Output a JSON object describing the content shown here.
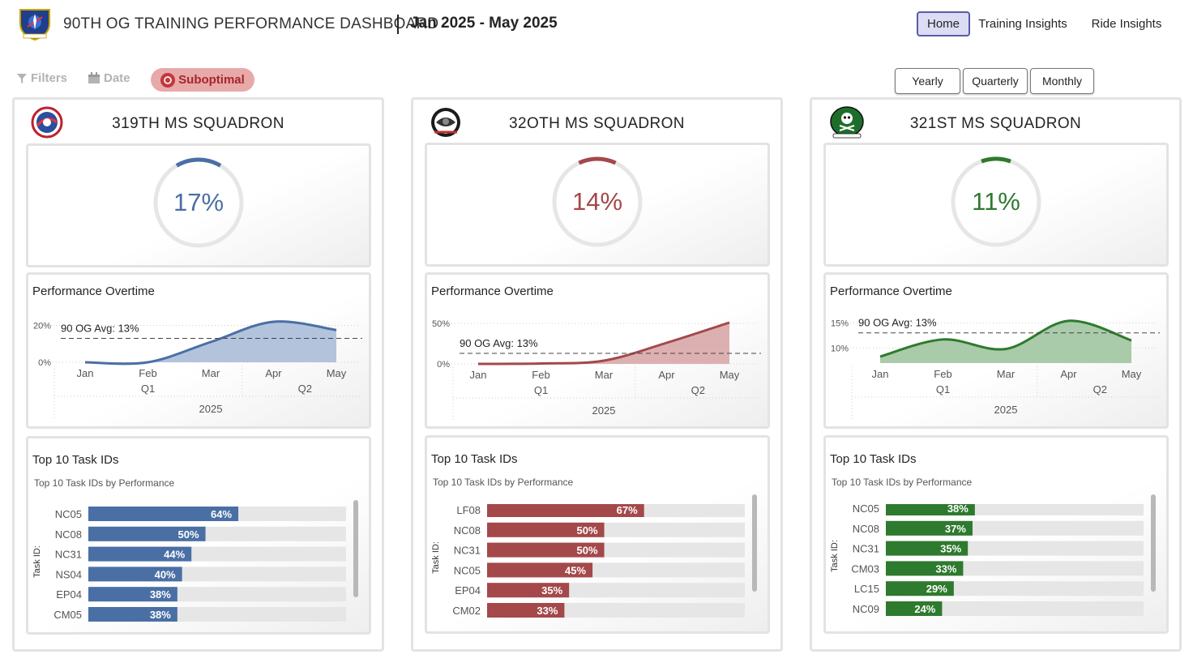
{
  "header": {
    "title": "90TH OG TRAINING PERFORMANCE DASHBOARD",
    "date_range": "Jan 2025 - May 2025",
    "logo_icon": "90th-og-wing-emblem-icon",
    "nav": [
      "Home",
      "Training Insights",
      "Ride Insights"
    ],
    "active_nav": "Home"
  },
  "toolbar": {
    "filters_label": "Filters",
    "date_label": "Date",
    "suboptimal_label": "Suboptimal"
  },
  "period_buttons": [
    "Yearly",
    "Quarterly",
    "Monthly"
  ],
  "squadrons": [
    {
      "name": "319TH MS SQUADRON",
      "logo_icon": "319th-squadron-patch-icon",
      "color": "#4a6fa5",
      "fill": "#b3c3dc",
      "kpi": "17%",
      "kpi_value": 0.17,
      "perf_title": "Performance Overtime",
      "chart_data": {
        "type": "area",
        "x": [
          "Jan",
          "Feb",
          "Mar",
          "Apr",
          "May"
        ],
        "quarters": [
          "Q1",
          "Q2"
        ],
        "year": "2025",
        "values": [
          0,
          0,
          11,
          22,
          17.5
        ],
        "yticks": [
          "20%",
          "0%"
        ],
        "ytick_values": [
          20,
          0
        ],
        "ylim": [
          0,
          22
        ],
        "avg_label": "90 OG Avg: 13%",
        "avg_value": 13
      },
      "top_title": "Top 10 Task IDs",
      "top_sub": "Top 10 Task IDs by Performance",
      "axis_label": "Task ID:",
      "tasks": [
        {
          "id": "NC05",
          "label": "64%",
          "value": 64
        },
        {
          "id": "NC08",
          "label": "50%",
          "value": 50
        },
        {
          "id": "NC31",
          "label": "44%",
          "value": 44
        },
        {
          "id": "NS04",
          "label": "40%",
          "value": 40
        },
        {
          "id": "EP04",
          "label": "38%",
          "value": 38
        },
        {
          "id": "CM05",
          "label": "38%",
          "value": 38
        }
      ]
    },
    {
      "name": "32OTH MS SQUADRON",
      "logo_icon": "320th-squadron-patch-icon",
      "color": "#a4484a",
      "fill": "#dcb0b1",
      "kpi": "14%",
      "kpi_value": 0.14,
      "perf_title": "Performance Overtime",
      "chart_data": {
        "type": "area",
        "x": [
          "Jan",
          "Feb",
          "Mar",
          "Apr",
          "May"
        ],
        "quarters": [
          "Q1",
          "Q2"
        ],
        "year": "2025",
        "values": [
          0,
          0.5,
          4,
          26,
          51
        ],
        "yticks": [
          "50%",
          "0%"
        ],
        "ytick_values": [
          50,
          0
        ],
        "ylim": [
          0,
          55
        ],
        "avg_label": "90 OG Avg: 13%",
        "avg_value": 13
      },
      "top_title": "Top 10 Task IDs",
      "top_sub": "Top 10 Task IDs by Performance",
      "axis_label": "Task ID:",
      "tasks": [
        {
          "id": "LF08",
          "label": "67%",
          "value": 67
        },
        {
          "id": "NC08",
          "label": "50%",
          "value": 50
        },
        {
          "id": "NC31",
          "label": "50%",
          "value": 50
        },
        {
          "id": "NC05",
          "label": "45%",
          "value": 45
        },
        {
          "id": "EP04",
          "label": "35%",
          "value": 35
        },
        {
          "id": "CM02",
          "label": "33%",
          "value": 33
        }
      ]
    },
    {
      "name": "321ST MS SQUADRON",
      "logo_icon": "321st-squadron-skull-patch-icon",
      "color": "#2e7a2e",
      "fill": "#a9cba9",
      "kpi": "11%",
      "kpi_value": 0.11,
      "perf_title": "Performance Overtime",
      "chart_data": {
        "type": "area",
        "x": [
          "Jan",
          "Feb",
          "Mar",
          "Apr",
          "May"
        ],
        "quarters": [
          "Q1",
          "Q2"
        ],
        "year": "2025",
        "values": [
          8.3,
          11.7,
          9.8,
          15.4,
          11.5
        ],
        "yticks": [
          "15%",
          "10%"
        ],
        "ytick_values": [
          15,
          10
        ],
        "ylim": [
          7,
          16.5
        ],
        "avg_label": "90 OG Avg: 13%",
        "avg_value": 13
      },
      "top_title": "Top 10 Task IDs",
      "top_sub": "Top 10 Task IDs by Performance",
      "axis_label": "Task ID:",
      "tasks": [
        {
          "id": "NC05",
          "label": "38%",
          "value": 38
        },
        {
          "id": "NC08",
          "label": "37%",
          "value": 37
        },
        {
          "id": "NC31",
          "label": "35%",
          "value": 35
        },
        {
          "id": "CM03",
          "label": "33%",
          "value": 33
        },
        {
          "id": "LC15",
          "label": "29%",
          "value": 29
        },
        {
          "id": "NC09",
          "label": "24%",
          "value": 24
        }
      ]
    }
  ]
}
